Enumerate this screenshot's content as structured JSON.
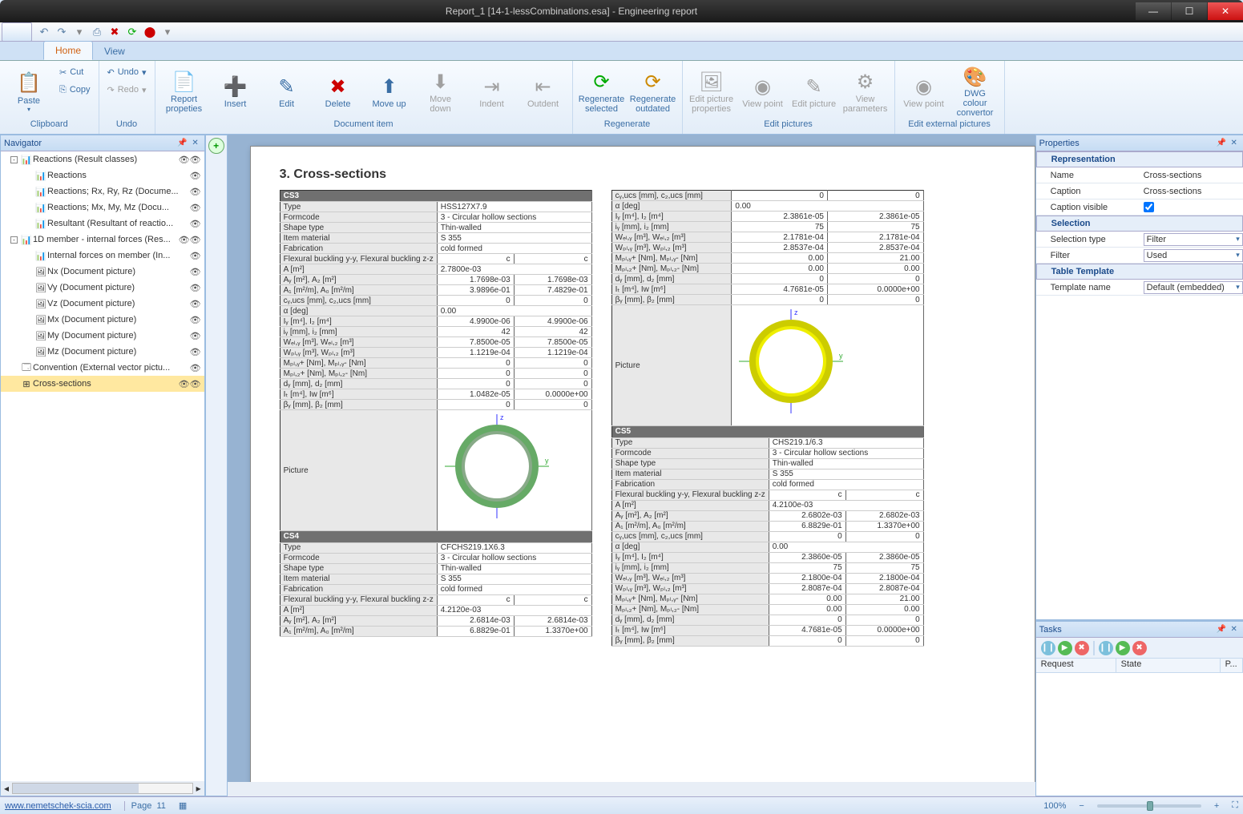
{
  "window": {
    "title": "Report_1 [14-1-lessCombinations.esa] - Engineering report"
  },
  "tabs": {
    "home": "Home",
    "view": "View"
  },
  "ribbon": {
    "clipboard": {
      "label": "Clipboard",
      "paste": "Paste",
      "cut": "Cut",
      "copy": "Copy"
    },
    "undo": {
      "label": "Undo",
      "undo": "Undo",
      "redo": "Redo"
    },
    "docitem": {
      "label": "Document item",
      "report": "Report propeties",
      "insert": "Insert",
      "edit": "Edit",
      "delete": "Delete",
      "moveup": "Move up",
      "movedown": "Move down",
      "indent": "Indent",
      "outdent": "Outdent"
    },
    "regen": {
      "label": "Regenerate",
      "sel": "Regenerate selected",
      "out": "Regenerate outdated"
    },
    "editpics": {
      "label": "Edit pictures",
      "props": "Edit picture properties",
      "vpoint": "View point",
      "editpic": "Edit picture",
      "vparams": "View parameters"
    },
    "extpics": {
      "label": "Edit external pictures",
      "vpoint": "View point",
      "dwg": "DWG colour convertor"
    }
  },
  "navigator": {
    "title": "Navigator",
    "tree": [
      {
        "ind": 0,
        "exp": "-",
        "ico": "📊",
        "lbl": "Reactions (Result classes)",
        "eyes": 2
      },
      {
        "ind": 1,
        "ico": "📊",
        "lbl": "Reactions",
        "eyes": 1
      },
      {
        "ind": 1,
        "ico": "📊",
        "lbl": "Reactions; Rx, Ry, Rz (Docume...",
        "eyes": 1
      },
      {
        "ind": 1,
        "ico": "📊",
        "lbl": "Reactions; Mx, My, Mz (Docu...",
        "eyes": 1
      },
      {
        "ind": 1,
        "ico": "📊",
        "lbl": "Resultant (Resultant of reactio...",
        "eyes": 1
      },
      {
        "ind": 0,
        "exp": "-",
        "ico": "📊",
        "lbl": "1D member - internal forces (Res...",
        "eyes": 2
      },
      {
        "ind": 1,
        "ico": "📊",
        "lbl": "Internal forces on member (In...",
        "eyes": 1
      },
      {
        "ind": 1,
        "ico": "🖼",
        "lbl": "Nx (Document picture)",
        "eyes": 1
      },
      {
        "ind": 1,
        "ico": "🖼",
        "lbl": "Vy (Document picture)",
        "eyes": 1
      },
      {
        "ind": 1,
        "ico": "🖼",
        "lbl": "Vz (Document picture)",
        "eyes": 1
      },
      {
        "ind": 1,
        "ico": "🖼",
        "lbl": "Mx (Document picture)",
        "eyes": 1
      },
      {
        "ind": 1,
        "ico": "🖼",
        "lbl": "My (Document picture)",
        "eyes": 1
      },
      {
        "ind": 1,
        "ico": "🖼",
        "lbl": "Mz (Document picture)",
        "eyes": 1
      },
      {
        "ind": 0,
        "ico": "🗔",
        "lbl": "Convention (External vector pictu...",
        "eyes": 1
      },
      {
        "ind": 0,
        "ico": "⊞",
        "lbl": "Cross-sections",
        "eyes": 2,
        "sel": true
      }
    ]
  },
  "report": {
    "heading": "3. Cross-sections",
    "cs3": {
      "name": "CS3",
      "rows": [
        [
          "Type",
          "HSS127X7.9",
          ""
        ],
        [
          "Formcode",
          "3 - Circular hollow sections",
          ""
        ],
        [
          "Shape type",
          "Thin-walled",
          ""
        ],
        [
          "Item material",
          "S 355",
          ""
        ],
        [
          "Fabrication",
          "cold formed",
          ""
        ],
        [
          "Flexural buckling y-y, Flexural buckling z-z",
          "c",
          "c"
        ],
        [
          "A [m²]",
          "2.7800e-03",
          ""
        ],
        [
          "Aᵧ [m²], A₂ [m²]",
          "1.7698e-03",
          "1.7698e-03"
        ],
        [
          "A₁ [m²/m], A₀ [m²/m]",
          "3.9896e-01",
          "7.4829e-01"
        ],
        [
          "cᵧ,ucs [mm], c₂,ucs [mm]",
          "0",
          "0"
        ],
        [
          "α [deg]",
          "0.00",
          ""
        ],
        [
          "Iᵧ [m⁴], I₂ [m⁴]",
          "4.9900e-06",
          "4.9900e-06"
        ],
        [
          "iᵧ [mm], i₂ [mm]",
          "42",
          "42"
        ],
        [
          "Wₑₗ,ᵧ [m³], Wₑₗ,₂ [m³]",
          "7.8500e-05",
          "7.8500e-05"
        ],
        [
          "Wₚₗ,ᵧ [m³], Wₚₗ,₂ [m³]",
          "1.1219e-04",
          "1.1219e-04"
        ],
        [
          "Mₚₗ,ᵧ+ [Nm], Mₚₗ,ᵧ- [Nm]",
          "0",
          "0"
        ],
        [
          "Mₚₗ,₂+ [Nm], Mₚₗ,₂- [Nm]",
          "0",
          "0"
        ],
        [
          "dᵧ [mm], d₂ [mm]",
          "0",
          "0"
        ],
        [
          "Iₜ [m⁴], Iw [m⁶]",
          "1.0482e-05",
          "0.0000e+00"
        ],
        [
          "βᵧ [mm], β₂ [mm]",
          "0",
          "0"
        ]
      ],
      "picture": "Picture"
    },
    "cs4": {
      "name": "CS4",
      "rows": [
        [
          "Type",
          "CFCHS219.1X6.3",
          ""
        ],
        [
          "Formcode",
          "3 - Circular hollow sections",
          ""
        ],
        [
          "Shape type",
          "Thin-walled",
          ""
        ],
        [
          "Item material",
          "S 355",
          ""
        ],
        [
          "Fabrication",
          "cold formed",
          ""
        ],
        [
          "Flexural buckling y-y, Flexural buckling z-z",
          "c",
          "c"
        ],
        [
          "A [m²]",
          "4.2120e-03",
          ""
        ],
        [
          "Aᵧ [m²], A₂ [m²]",
          "2.6814e-03",
          "2.6814e-03"
        ],
        [
          "A₁ [m²/m], A₀ [m²/m]",
          "6.8829e-01",
          "1.3370e+00"
        ]
      ]
    },
    "cs3cont": {
      "rows": [
        [
          "cᵧ,ucs [mm], c₂,ucs [mm]",
          "0",
          "0"
        ],
        [
          "α [deg]",
          "0.00",
          ""
        ],
        [
          "Iᵧ [m⁴], I₂ [m⁴]",
          "2.3861e-05",
          "2.3861e-05"
        ],
        [
          "iᵧ [mm], i₂ [mm]",
          "75",
          "75"
        ],
        [
          "Wₑₗ,ᵧ [m³], Wₑₗ,₂ [m³]",
          "2.1781e-04",
          "2.1781e-04"
        ],
        [
          "Wₚₗ,ᵧ [m³], Wₚₗ,₂ [m³]",
          "2.8537e-04",
          "2.8537e-04"
        ],
        [
          "Mₚₗ,ᵧ+ [Nm], Mₚₗ,ᵧ- [Nm]",
          "0.00",
          "21.00"
        ],
        [
          "Mₚₗ,₂+ [Nm], Mₚₗ,₂- [Nm]",
          "0.00",
          "0.00"
        ],
        [
          "dᵧ [mm], d₂ [mm]",
          "0",
          "0"
        ],
        [
          "Iₜ [m⁴], Iw [m⁶]",
          "4.7681e-05",
          "0.0000e+00"
        ],
        [
          "βᵧ [mm], β₂ [mm]",
          "0",
          "0"
        ]
      ],
      "picture": "Picture"
    },
    "cs5": {
      "name": "CS5",
      "rows": [
        [
          "Type",
          "CHS219.1/6.3",
          ""
        ],
        [
          "Formcode",
          "3 - Circular hollow sections",
          ""
        ],
        [
          "Shape type",
          "Thin-walled",
          ""
        ],
        [
          "Item material",
          "S 355",
          ""
        ],
        [
          "Fabrication",
          "cold formed",
          ""
        ],
        [
          "Flexural buckling y-y, Flexural buckling z-z",
          "c",
          "c"
        ],
        [
          "A [m²]",
          "4.2100e-03",
          ""
        ],
        [
          "Aᵧ [m²], A₂ [m²]",
          "2.6802e-03",
          "2.6802e-03"
        ],
        [
          "A₁ [m²/m], A₀ [m²/m]",
          "6.8829e-01",
          "1.3370e+00"
        ],
        [
          "cᵧ,ucs [mm], c₂,ucs [mm]",
          "0",
          "0"
        ],
        [
          "α [deg]",
          "0.00",
          ""
        ],
        [
          "Iᵧ [m⁴], I₂ [m⁴]",
          "2.3860e-05",
          "2.3860e-05"
        ],
        [
          "iᵧ [mm], i₂ [mm]",
          "75",
          "75"
        ],
        [
          "Wₑₗ,ᵧ [m³], Wₑₗ,₂ [m³]",
          "2.1800e-04",
          "2.1800e-04"
        ],
        [
          "Wₚₗ,ᵧ [m³], Wₚₗ,₂ [m³]",
          "2.8087e-04",
          "2.8087e-04"
        ],
        [
          "Mₚₗ,ᵧ+ [Nm], Mₚₗ,ᵧ- [Nm]",
          "0.00",
          "21.00"
        ],
        [
          "Mₚₗ,₂+ [Nm], Mₚₗ,₂- [Nm]",
          "0.00",
          "0.00"
        ],
        [
          "dᵧ [mm], d₂ [mm]",
          "0",
          "0"
        ],
        [
          "Iₜ [m⁴], Iw [m⁶]",
          "4.7681e-05",
          "0.0000e+00"
        ],
        [
          "βᵧ [mm], β₂ [mm]",
          "0",
          "0"
        ]
      ]
    }
  },
  "properties": {
    "title": "Properties",
    "groups": {
      "rep": {
        "label": "Representation",
        "rows": [
          [
            "Name",
            "Cross-sections"
          ],
          [
            "Caption",
            "Cross-sections"
          ],
          [
            "Caption visible",
            "☑"
          ]
        ]
      },
      "sel": {
        "label": "Selection",
        "rows": [
          [
            "Selection type",
            "Filter"
          ],
          [
            "Filter",
            "Used"
          ]
        ]
      },
      "tpl": {
        "label": "Table Template",
        "rows": [
          [
            "Template name",
            "Default (embedded)"
          ]
        ]
      }
    }
  },
  "tasks": {
    "title": "Tasks",
    "cols": [
      "Request",
      "State",
      "P..."
    ]
  },
  "status": {
    "link": "www.nemetschek-scia.com",
    "page_label": "Page",
    "page": "11",
    "zoom": "100%"
  }
}
